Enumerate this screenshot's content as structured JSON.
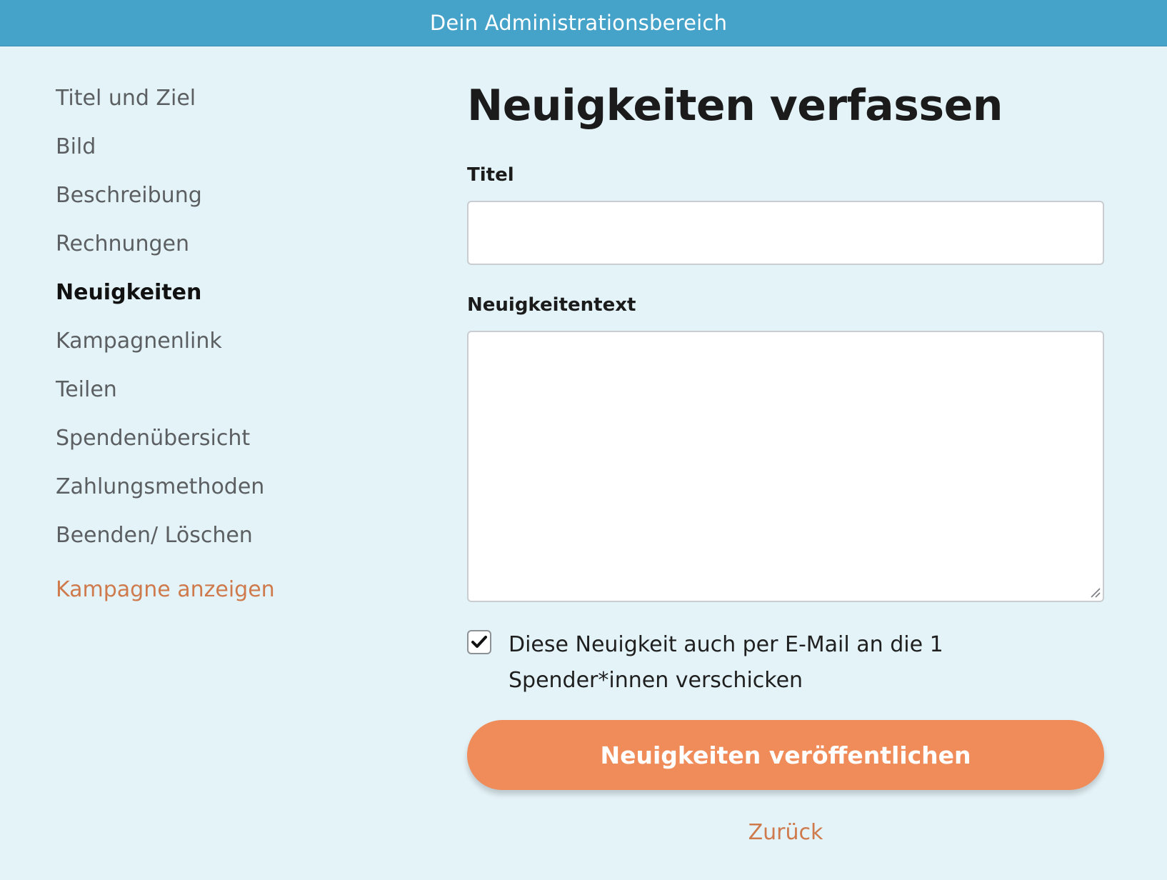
{
  "header": {
    "title": "Dein Administrationsbereich"
  },
  "sidebar": {
    "items": [
      {
        "label": "Titel und Ziel",
        "active": false
      },
      {
        "label": "Bild",
        "active": false
      },
      {
        "label": "Beschreibung",
        "active": false
      },
      {
        "label": "Rechnungen",
        "active": false
      },
      {
        "label": "Neuigkeiten",
        "active": true
      },
      {
        "label": "Kampagnenlink",
        "active": false
      },
      {
        "label": "Teilen",
        "active": false
      },
      {
        "label": "Spendenübersicht",
        "active": false
      },
      {
        "label": "Zahlungsmethoden",
        "active": false
      },
      {
        "label": "Beenden/ Löschen",
        "active": false
      }
    ],
    "view_campaign": "Kampagne anzeigen"
  },
  "main": {
    "title": "Neuigkeiten verfassen",
    "title_field": {
      "label": "Titel",
      "value": "",
      "placeholder": ""
    },
    "text_field": {
      "label": "Neuigkeitentext",
      "value": "",
      "placeholder": ""
    },
    "email_checkbox": {
      "checked": true,
      "label": "Diese Neuigkeit auch per E-Mail an die 1 Spender*innen verschicken"
    },
    "publish_button": "Neuigkeiten veröffentlichen",
    "back_link": "Zurück"
  },
  "colors": {
    "header_bg": "#45a2c8",
    "page_bg": "#e4f3f8",
    "accent": "#f08c5a",
    "link": "#cf7a4c"
  }
}
